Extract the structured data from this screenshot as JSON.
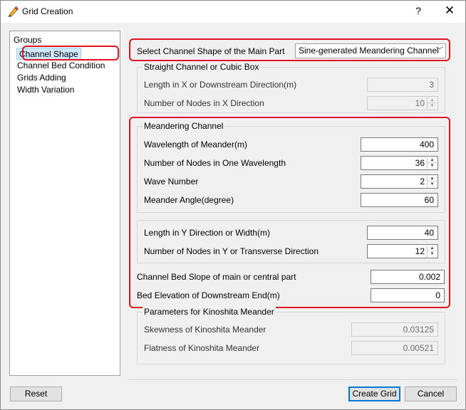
{
  "window": {
    "title": "Grid Creation",
    "help_glyph": "?",
    "close_glyph": "✕",
    "icon": "pencil-icon"
  },
  "groups": {
    "header": "Groups",
    "items": [
      {
        "label": "Channel Shape",
        "selected": true
      },
      {
        "label": "Channel Bed Condition"
      },
      {
        "label": "Grids Adding"
      },
      {
        "label": "Width Variation"
      }
    ]
  },
  "main": {
    "shape_label": "Select Channel Shape of the Main Part",
    "shape_value": "Sine-generated Meandering Channel",
    "straight": {
      "title": "Straight Channel or Cubic Box",
      "length_label": "Length in X or Downstream Direction(m)",
      "length_value": "3",
      "nodes_label": "Number of Nodes in X Direction",
      "nodes_value": "10"
    },
    "meander": {
      "title": "Meandering Channel",
      "wavelength_label": "Wavelength of Meander(m)",
      "wavelength_value": "400",
      "nodes_wave_label": "Number of Nodes in One Wavelength",
      "nodes_wave_value": "36",
      "wave_number_label": "Wave Number",
      "wave_number_value": "2",
      "angle_label": "Meander Angle(degree)",
      "angle_value": "60"
    },
    "width": {
      "length_label": "Length in Y Direction or Width(m)",
      "length_value": "40",
      "nodes_label": "Number of Nodes in Y or Transverse Direction",
      "nodes_value": "12"
    },
    "slope_label": "Channel Bed Slope of main or central part",
    "slope_value": "0.002",
    "elevation_label": "Bed Elevation of Downstream End(m)",
    "elevation_value": "0",
    "kinoshita": {
      "title": "Parameters for Kinoshita Meander",
      "skewness_label": "Skewness of Kinoshita Meander",
      "skewness_value": "0.03125",
      "flatness_label": "Flatness of Kinoshita Meander",
      "flatness_value": "0.00521"
    }
  },
  "buttons": {
    "reset": "Reset",
    "create": "Create Grid",
    "cancel": "Cancel"
  },
  "colors": {
    "highlight_border": "#e0141e",
    "selection_bg": "#cde8ff",
    "default_button_border": "#0078d7"
  }
}
